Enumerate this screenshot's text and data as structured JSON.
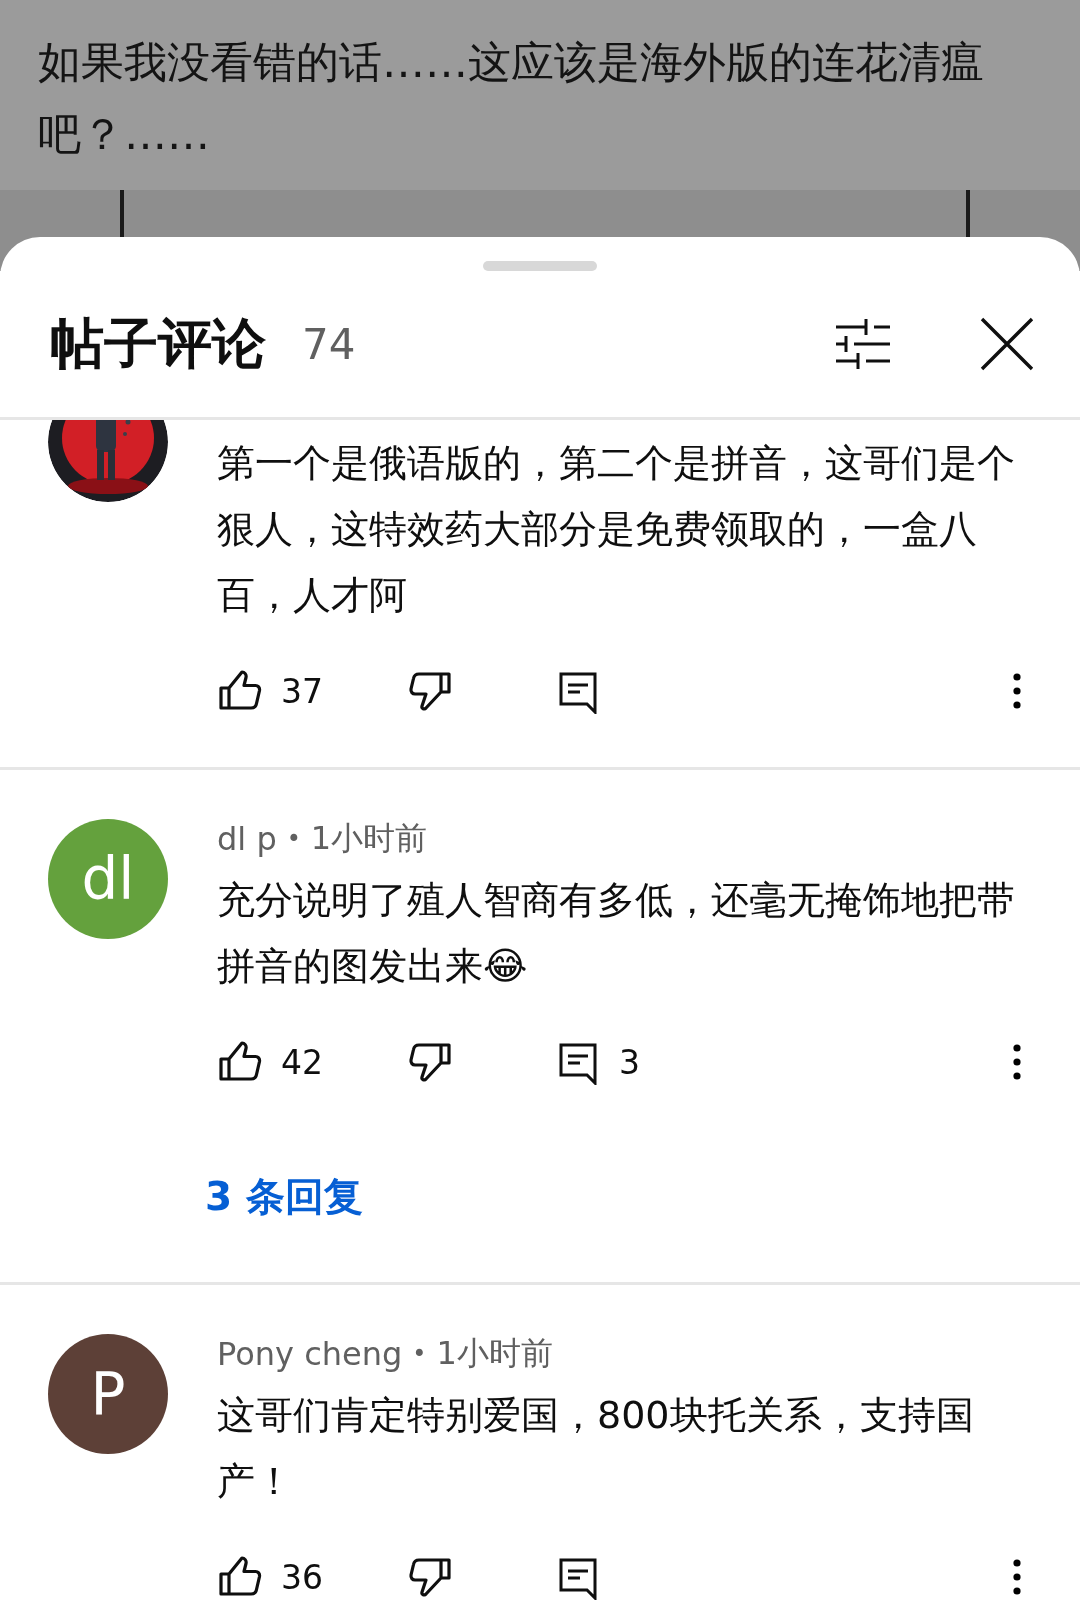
{
  "post": {
    "text": "如果我没看错的话……这应该是海外版的连花清瘟吧？……"
  },
  "sheet": {
    "title": "帖子评论",
    "count": "74"
  },
  "comments": [
    {
      "text": "第一个是俄语版的，第二个是拼音，这哥们是个狠人，这特效药大部分是免费领取的，一盒八百，人才阿",
      "likes": "37"
    },
    {
      "avatar": {
        "kind": "letter",
        "letter": "dl",
        "color": "#64a13d"
      },
      "author": "dl p",
      "separator": "•",
      "time": "1小时前",
      "text": "充分说明了殖人智商有多低，还毫无掩饰地把带拼音的图发出来😂",
      "likes": "42",
      "reply_count": "3",
      "replies_link": "3 条回复"
    },
    {
      "avatar": {
        "kind": "letter",
        "letter": "P",
        "color": "#5d4037"
      },
      "author": "Pony cheng",
      "separator": "•",
      "time": "1小时前",
      "text": "这哥们肯定特别爱国，800块托关系，支持国产！",
      "likes": "36"
    }
  ]
}
